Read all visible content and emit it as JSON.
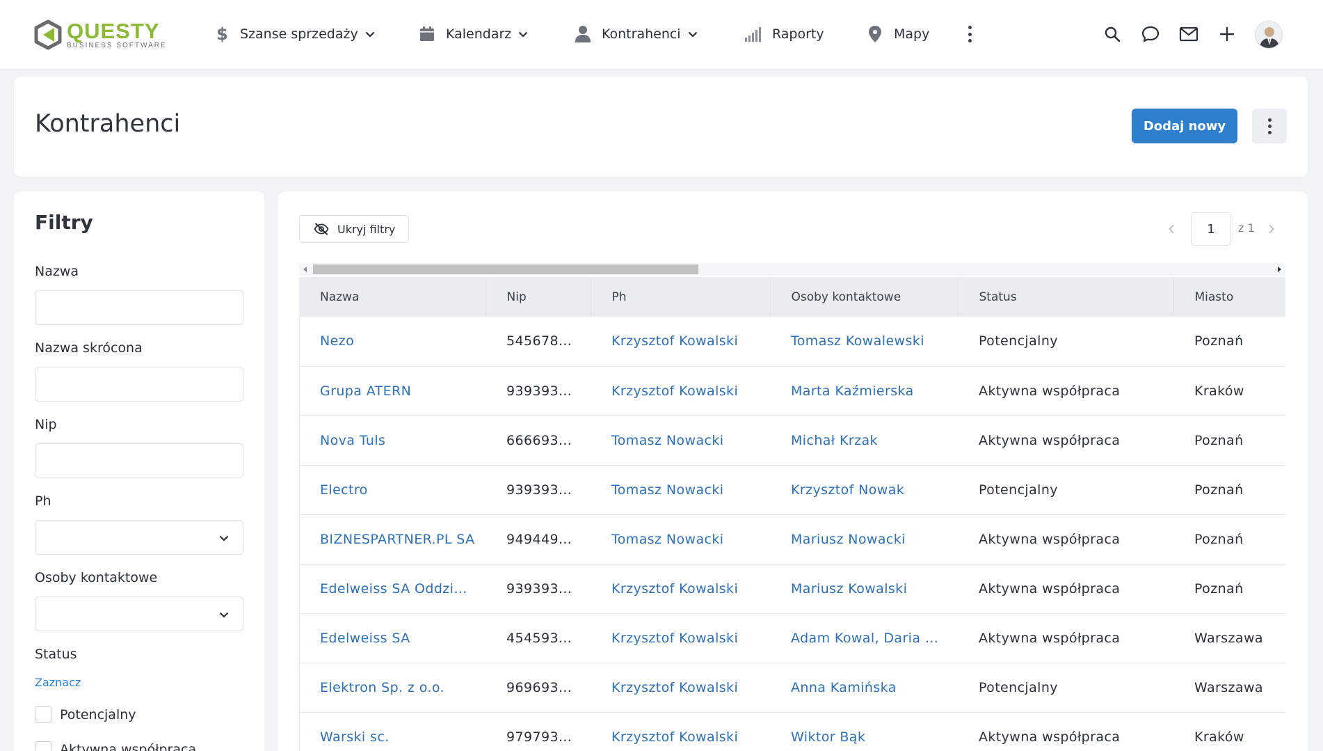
{
  "brand": {
    "name": "QUESTY",
    "tagline": "BUSINESS SOFTWARE",
    "color": "#8dba36"
  },
  "nav": {
    "items": [
      {
        "label": "Szanse sprzedaży",
        "icon": "dollar-icon"
      },
      {
        "label": "Kalendarz",
        "icon": "calendar-icon"
      },
      {
        "label": "Kontrahenci",
        "icon": "user-icon"
      },
      {
        "label": "Raporty",
        "icon": "signal-bars-icon"
      },
      {
        "label": "Mapy",
        "icon": "map-pin-icon"
      }
    ],
    "tools": [
      "search-icon",
      "chat-icon",
      "mail-icon",
      "plus-icon"
    ]
  },
  "header": {
    "title": "Kontrahenci",
    "add_label": "Dodaj nowy"
  },
  "filters": {
    "title": "Filtry",
    "name_label": "Nazwa",
    "short_name_label": "Nazwa skrócona",
    "nip_label": "Nip",
    "ph_label": "Ph",
    "contacts_label": "Osoby kontaktowe",
    "status_label": "Status",
    "select_all_label": "Zaznacz",
    "status_options": [
      "Potencjalny",
      "Aktywna współpraca"
    ]
  },
  "toolbar": {
    "hide_filters_label": "Ukryj filtry"
  },
  "pager": {
    "current": "1",
    "of_label": "z 1"
  },
  "table": {
    "columns": [
      "Nazwa",
      "Nip",
      "Ph",
      "Osoby kontaktowe",
      "Status",
      "Miasto"
    ],
    "rows": [
      [
        "Nezo",
        "545678…",
        "Krzysztof Kowalski",
        "Tomasz Kowalewski",
        "Potencjalny",
        "Poznań"
      ],
      [
        "Grupa ATERN",
        "939393…",
        "Krzysztof Kowalski",
        "Marta Kaźmierska",
        "Aktywna współpraca",
        "Kraków"
      ],
      [
        "Nova Tuls",
        "666693…",
        "Tomasz Nowacki",
        "Michał Krzak",
        "Aktywna współpraca",
        "Poznań"
      ],
      [
        "Electro",
        "939393…",
        "Tomasz Nowacki",
        "Krzysztof Nowak",
        "Potencjalny",
        "Poznań"
      ],
      [
        "BIZNESPARTNER.PL SA",
        "949449…",
        "Tomasz Nowacki",
        "Mariusz Nowacki",
        "Aktywna współpraca",
        "Poznań"
      ],
      [
        "Edelweiss SA Oddzi…",
        "939393…",
        "Krzysztof Kowalski",
        "Mariusz Kowalski",
        "Aktywna współpraca",
        "Poznań"
      ],
      [
        "Edelweiss SA",
        "454593…",
        "Krzysztof Kowalski",
        "Adam Kowal, Daria …",
        "Aktywna współpraca",
        "Warszawa"
      ],
      [
        "Elektron Sp. z o.o.",
        "969693…",
        "Krzysztof Kowalski",
        "Anna Kamińska",
        "Potencjalny",
        "Warszawa"
      ],
      [
        "Warski sc.",
        "979793…",
        "Krzysztof Kowalski",
        "Wiktor Bąk",
        "Aktywna współpraca",
        "Kraków"
      ]
    ]
  },
  "colors": {
    "accent": "#2f7fcf",
    "link": "#2f6fb4",
    "header_bg": "#e9edf2",
    "page_bg": "#f2f3f5"
  }
}
